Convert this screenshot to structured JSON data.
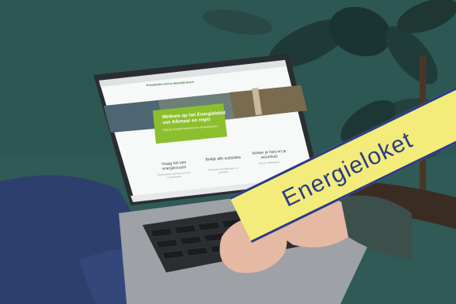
{
  "photo": {
    "description_colors": {
      "wall": "#2f5a56",
      "banner_fill": "#f3ec7a",
      "banner_text": "#2b3b8a",
      "site_green": "#8cbf2e"
    }
  },
  "website": {
    "logo_text": "Energieloket Zuid en Westelijk Noord",
    "hero_title": "Welkom op het Energieloket van Alkmaar en regio",
    "hero_subtitle": "Hulp bij energie besparen en verduurzamen",
    "cards": [
      {
        "title": "Vraag het een energiecoach",
        "text": "Gratis advies aan huis van een energiecoach"
      },
      {
        "title": "Bekijk alle subsidies",
        "text": "Overzicht van regelingen en subsidies"
      },
      {
        "title": "Isoleer je huis en je woonhuis",
        "text": "Tips en maatregelen"
      }
    ]
  },
  "banner": {
    "label": "Energieloket"
  }
}
